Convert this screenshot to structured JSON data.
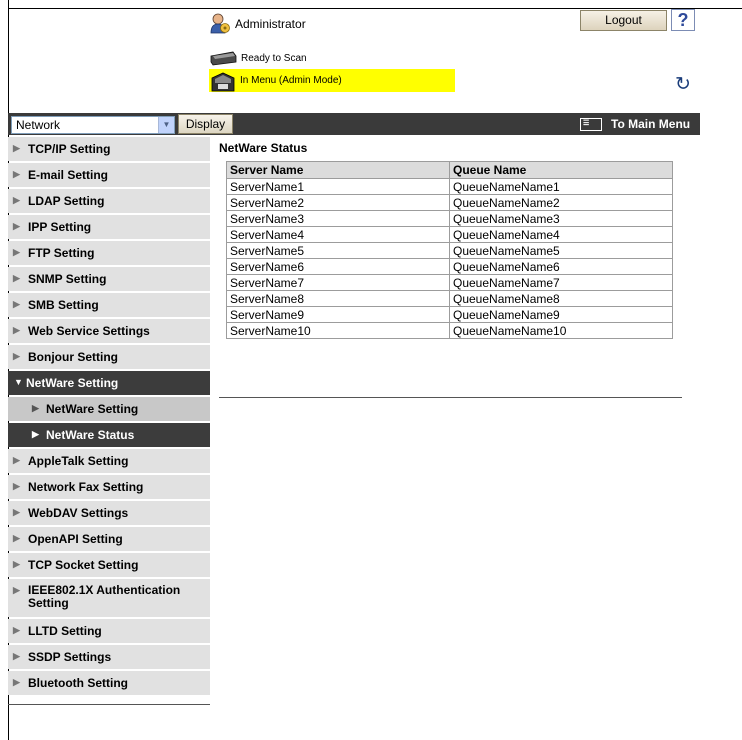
{
  "header": {
    "user": "Administrator",
    "logout_label": "Logout",
    "help_label": "?",
    "status_ready": "Ready to Scan",
    "status_mode": "In Menu (Admin Mode)"
  },
  "navbar": {
    "select_value": "Network",
    "display_label": "Display",
    "main_menu_label": "To Main Menu"
  },
  "sidebar": {
    "items": [
      {
        "label": "TCP/IP Setting"
      },
      {
        "label": "E-mail Setting"
      },
      {
        "label": "LDAP Setting"
      },
      {
        "label": "IPP Setting"
      },
      {
        "label": "FTP Setting"
      },
      {
        "label": "SNMP Setting"
      },
      {
        "label": "SMB Setting"
      },
      {
        "label": "Web Service Settings"
      },
      {
        "label": "Bonjour Setting"
      },
      {
        "label": "NetWare Setting"
      },
      {
        "label": "NetWare Setting"
      },
      {
        "label": "NetWare Status"
      },
      {
        "label": "AppleTalk Setting"
      },
      {
        "label": "Network Fax Setting"
      },
      {
        "label": "WebDAV Settings"
      },
      {
        "label": "OpenAPI Setting"
      },
      {
        "label": "TCP Socket Setting"
      },
      {
        "label": "IEEE802.1X Authentication Setting"
      },
      {
        "label": "LLTD Setting"
      },
      {
        "label": "SSDP Settings"
      },
      {
        "label": "Bluetooth Setting"
      }
    ]
  },
  "content": {
    "title": "NetWare Status",
    "columns": [
      "Server Name",
      "Queue Name"
    ],
    "rows": [
      [
        "ServerName1",
        "QueueNameName1"
      ],
      [
        "ServerName2",
        "QueueNameName2"
      ],
      [
        "ServerName3",
        "QueueNameName3"
      ],
      [
        "ServerName4",
        "QueueNameName4"
      ],
      [
        "ServerName5",
        "QueueNameName5"
      ],
      [
        "ServerName6",
        "QueueNameName6"
      ],
      [
        "ServerName7",
        "QueueNameName7"
      ],
      [
        "ServerName8",
        "QueueNameName8"
      ],
      [
        "ServerName9",
        "QueueNameName9"
      ],
      [
        "ServerName10",
        "QueueNameName10"
      ]
    ]
  },
  "colors": {
    "status_highlight": "#ffff00",
    "navbar": "#3a3a3a",
    "sidebar_item": "#e1e1e1",
    "sidebar_active": "#3c3c3c"
  }
}
